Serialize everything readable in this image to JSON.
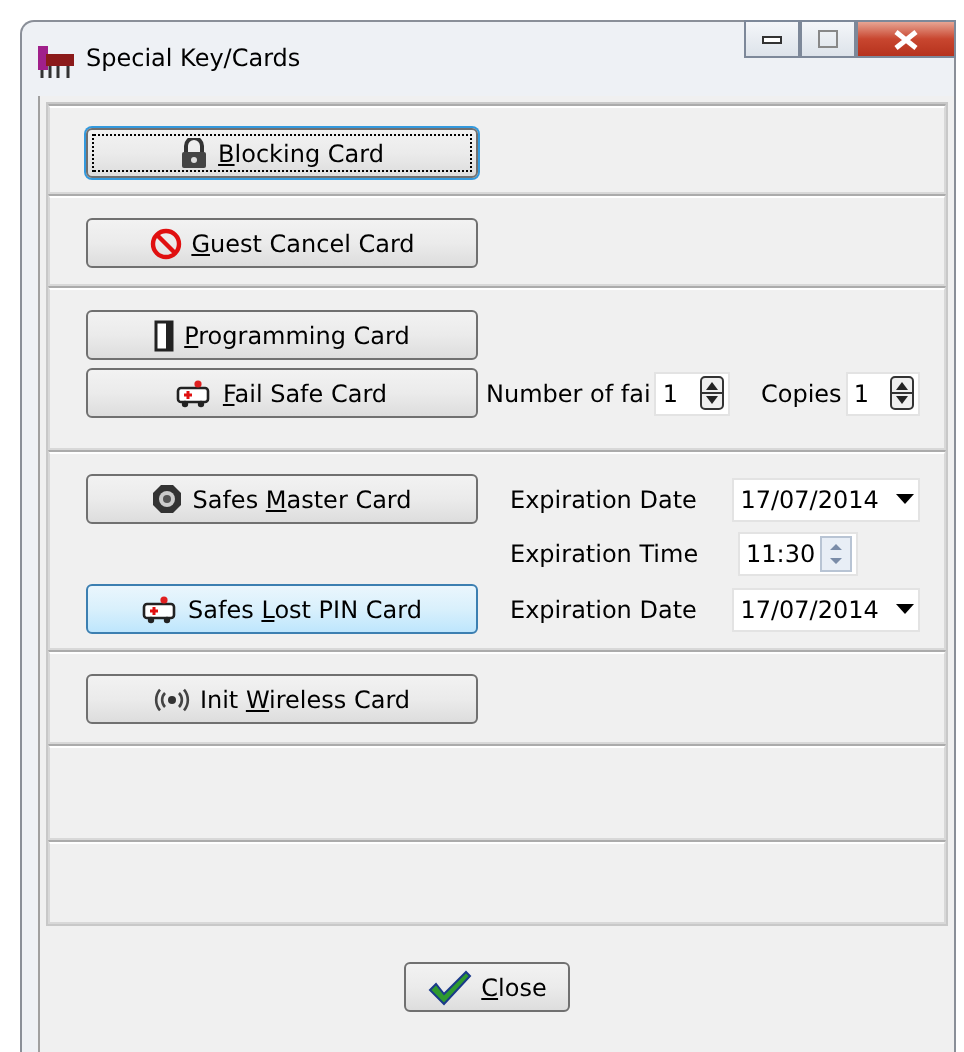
{
  "window": {
    "title": "Special Key/Cards"
  },
  "sections": [
    {
      "rows": [
        {
          "button": {
            "key": "B",
            "post": "locking Card",
            "focused": true,
            "hovered": false
          }
        }
      ]
    },
    {
      "rows": [
        {
          "button": {
            "key": "G",
            "post": "uest Cancel Card",
            "focused": false,
            "hovered": false
          }
        }
      ]
    },
    {
      "rows": [
        {
          "button": {
            "key": "P",
            "post": "rogramming Card",
            "focused": false,
            "hovered": false
          }
        },
        {
          "button": {
            "key": "F",
            "post": "ail Safe Card",
            "focused": false,
            "hovered": false
          },
          "fields": [
            {
              "kind": "spin",
              "label": "Number of fai",
              "value": "1"
            },
            {
              "kind": "spin",
              "label": "Copies",
              "value": "1"
            }
          ]
        }
      ]
    },
    {
      "rows": [
        {
          "button": {
            "pre": "Safes ",
            "key": "M",
            "post": "aster Card",
            "focused": false,
            "hovered": false
          },
          "fields": [
            {
              "kind": "date",
              "label": "Expiration Date",
              "value": "17/07/2014"
            }
          ]
        },
        {
          "fields": [
            {
              "kind": "time",
              "label": "Expiration Time",
              "value": "11:30"
            }
          ]
        },
        {
          "button": {
            "pre": "Safes ",
            "key": "L",
            "post": "ost PIN Card",
            "focused": false,
            "hovered": true
          },
          "fields": [
            {
              "kind": "date",
              "label": "Expiration Date",
              "value": "17/07/2014"
            }
          ]
        }
      ]
    },
    {
      "rows": [
        {
          "button": {
            "pre": "Init ",
            "key": "W",
            "post": "ireless Card",
            "focused": false,
            "hovered": false
          }
        }
      ]
    }
  ],
  "footer": {
    "button": {
      "key": "C",
      "post": "lose",
      "focused": false,
      "hovered": false
    }
  }
}
